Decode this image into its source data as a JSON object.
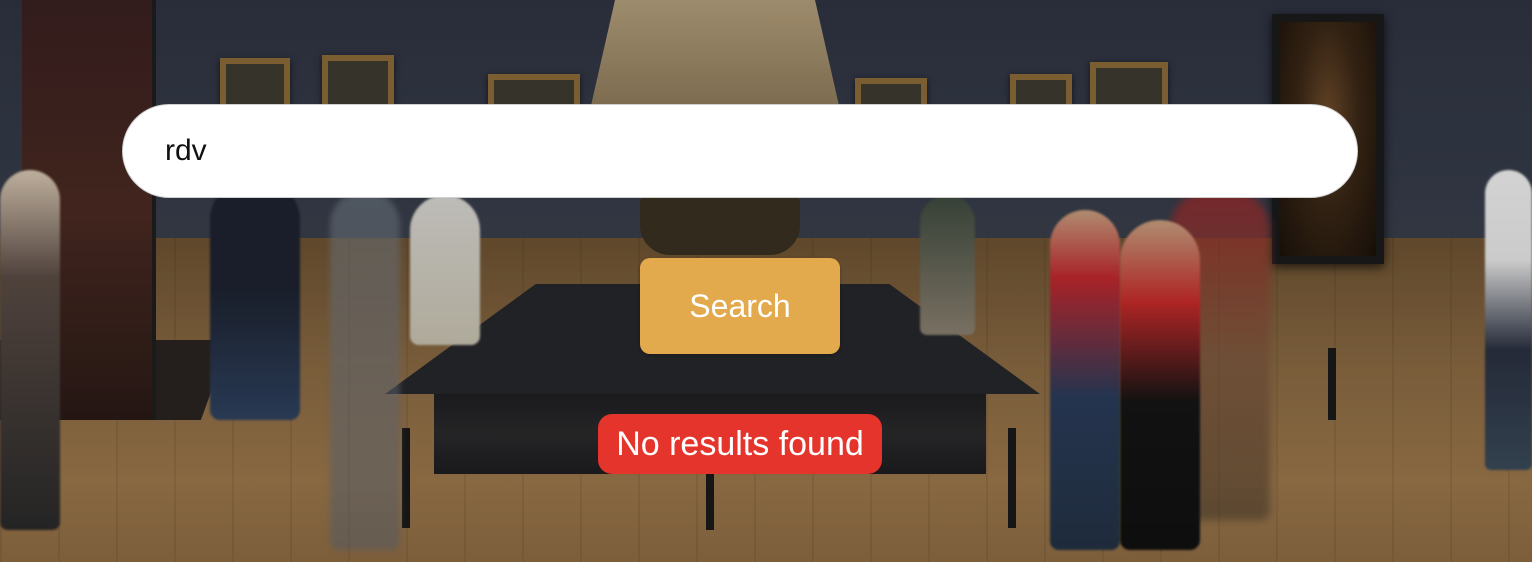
{
  "search": {
    "value": "rdv",
    "button_label": "Search"
  },
  "status": {
    "message": "No results found"
  },
  "colors": {
    "button": "#e3a94d",
    "error_badge": "#e5342b",
    "input_background": "#ffffff"
  },
  "background": {
    "description_icon": "museum-gallery-background"
  }
}
